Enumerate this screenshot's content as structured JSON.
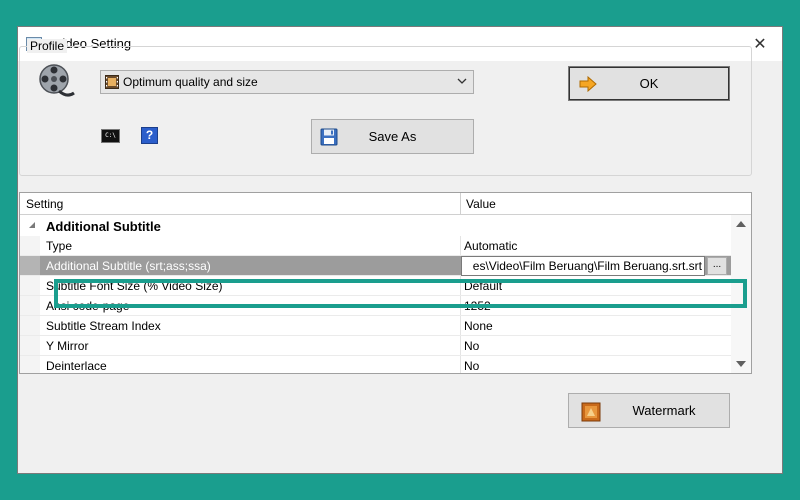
{
  "window": {
    "title": "Video Setting",
    "close_symbol": "✕"
  },
  "profile": {
    "group_label": "Profile",
    "selected": "Optimum quality and size",
    "ok_label": "OK",
    "save_as_label": "Save As",
    "cmd_icon_text": "C:\\",
    "help_icon_text": "?"
  },
  "grid": {
    "header_setting": "Setting",
    "header_value": "Value",
    "category": "Additional Subtitle",
    "rows": [
      {
        "name": "Type",
        "value": "Automatic"
      },
      {
        "name": "Additional Subtitle (srt;ass;ssa)",
        "value": "es\\Video\\Film Beruang\\Film Beruang.srt.srt"
      },
      {
        "name": "Subtitle Font Size (% Video Size)",
        "value": "Default"
      },
      {
        "name": "Ansi code-page",
        "value": "1252"
      },
      {
        "name": "Subtitle Stream Index",
        "value": "None"
      },
      {
        "name": "Y Mirror",
        "value": "No"
      },
      {
        "name": "Deinterlace",
        "value": "No"
      }
    ],
    "browse_label": "..."
  },
  "footer": {
    "watermark_label": "Watermark"
  },
  "colors": {
    "background": "#1a9e8e",
    "highlight": "#1a9e8e",
    "selected_row": "#9c9c9c"
  }
}
